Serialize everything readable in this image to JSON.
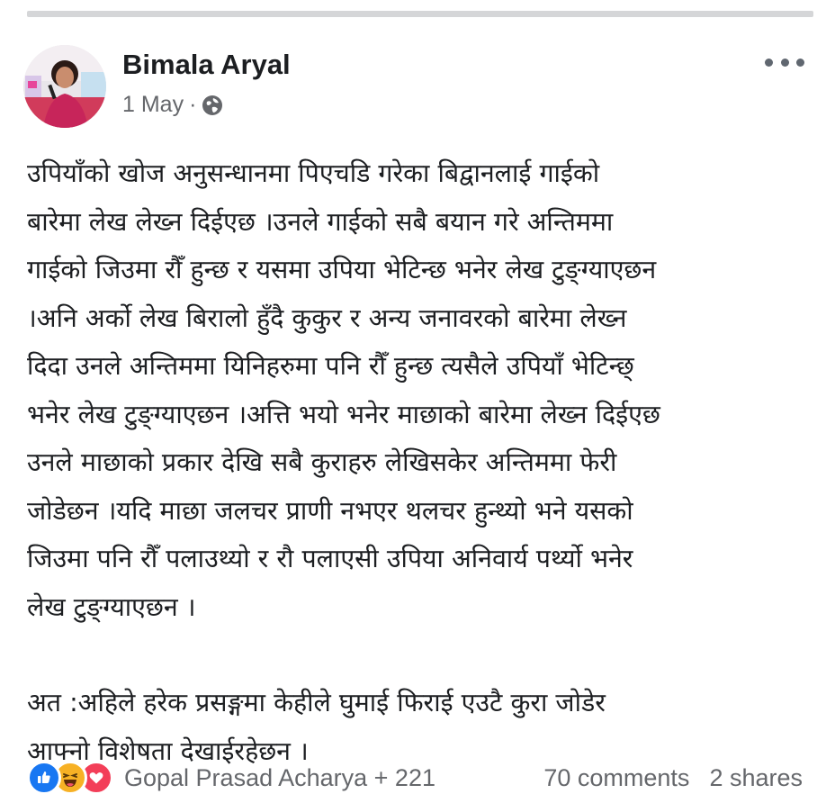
{
  "post": {
    "author": "Bimala Aryal",
    "date": "1 May",
    "separator": "·",
    "privacy_icon": "globe-icon",
    "more_icon": "more-horizontal-icon",
    "body_paragraph_1": "उपियाँको खोज अनुसन्धानमा पिएचडि गरेका बिद्वानलाई गाईको\nबारेमा लेख लेख्न दिईएछ ।उनले गाईको सबै बयान गरे अन्तिममा\nगाईको जिउमा रौँ हुन्छ र यसमा उपिया भेटिन्छ भनेर लेख टुङ्ग्याएछन\n।अनि अर्को लेख बिरालो हुँदै कुकुर र अन्य जनावरको बारेमा लेख्न\nदिदा उनले अन्तिममा यिनिहरुमा पनि रौँ हुन्छ त्यसैले उपियाँ भेटिन्छ्\nभनेर लेख टुङ्ग्याएछन ।अत्ति भयो भनेर माछाको बारेमा लेख्न दिईएछ\nउनले माछाको प्रकार देखि सबै कुराहरु लेखिसकेर अन्तिममा फेरी\nजोडेछन ।यदि माछा जलचर प्राणी नभएर थलचर हुन्थ्यो भने यसको\nजिउमा पनि रौँ पलाउथ्यो र रौ पलाएसी उपिया अनिवार्य पर्थ्यो भनेर\nलेख टुङ्ग्याएछन ।",
    "body_paragraph_2": "अत :अहिले हरेक प्रसङ्गमा केहीले घुमाई फिराई एउटै कुरा जोडेर\nआफ्नो विशेषता देखाईरहेछन ।"
  },
  "reactions": {
    "icons": [
      "like-icon",
      "haha-icon",
      "love-icon"
    ],
    "summary": "Gopal Prasad Acharya + 221"
  },
  "stats": {
    "comments": "70 comments",
    "shares": "2 shares"
  },
  "colors": {
    "like": "#1877f2",
    "haha": "#f7b125",
    "love": "#f33e58",
    "secondary_text": "#65676b"
  }
}
